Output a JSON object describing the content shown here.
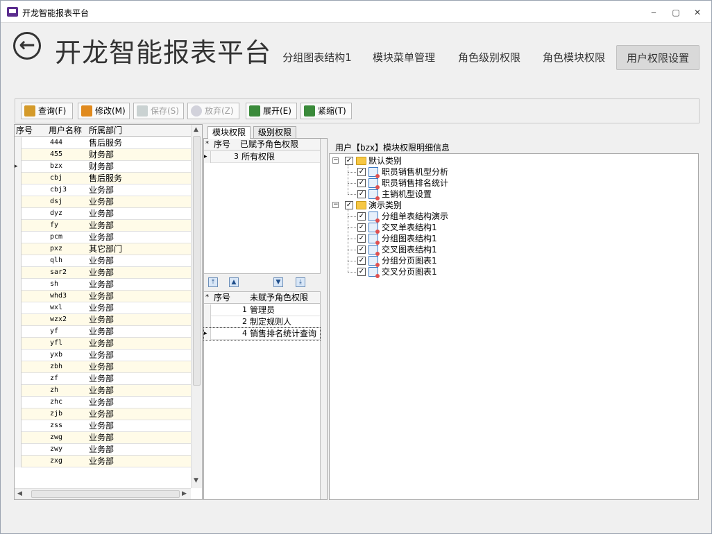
{
  "window": {
    "title": "开龙智能报表平台",
    "minimize": "‒",
    "maximize": "▢",
    "close": "✕"
  },
  "header": {
    "title": "开龙智能报表平台",
    "back_icon": "back-arrow-icon",
    "tabs": [
      {
        "label": "分组图表结构1"
      },
      {
        "label": "模块菜单管理"
      },
      {
        "label": "角色级别权限"
      },
      {
        "label": "角色模块权限"
      },
      {
        "label": "用户权限设置",
        "active": true
      }
    ]
  },
  "toolbar": {
    "buttons": [
      {
        "label": "查询(F)",
        "icon": "query-icon"
      },
      {
        "label": "修改(M)",
        "icon": "edit-icon"
      },
      {
        "label": "保存(S)",
        "icon": "save-icon",
        "disabled": true
      },
      {
        "label": "放弃(Z)",
        "icon": "discard-icon",
        "disabled": true
      },
      {
        "label": "展开(E)",
        "icon": "expand-icon"
      },
      {
        "label": "紧缩(T)",
        "icon": "collapse-icon"
      }
    ]
  },
  "user_grid": {
    "columns": [
      "序号",
      "用户名称",
      "所属部门"
    ],
    "rows": [
      [
        "444",
        "售后服务"
      ],
      [
        "455",
        "财务部"
      ],
      [
        "bzx",
        "财务部"
      ],
      [
        "cbj",
        "售后服务"
      ],
      [
        "cbj3",
        "业务部"
      ],
      [
        "dsj",
        "业务部"
      ],
      [
        "dyz",
        "业务部"
      ],
      [
        "fy",
        "业务部"
      ],
      [
        "pcm",
        "业务部"
      ],
      [
        "pxz",
        "其它部门"
      ],
      [
        "qlh",
        "业务部"
      ],
      [
        "sar2",
        "业务部"
      ],
      [
        "sh",
        "业务部"
      ],
      [
        "whd3",
        "业务部"
      ],
      [
        "wxl",
        "业务部"
      ],
      [
        "wzx2",
        "业务部"
      ],
      [
        "yf",
        "业务部"
      ],
      [
        "yfl",
        "业务部"
      ],
      [
        "yxb",
        "业务部"
      ],
      [
        "zbh",
        "业务部"
      ],
      [
        "zf",
        "业务部"
      ],
      [
        "zh",
        "业务部"
      ],
      [
        "zhc",
        "业务部"
      ],
      [
        "zjb",
        "业务部"
      ],
      [
        "zss",
        "业务部"
      ],
      [
        "zwg",
        "业务部"
      ],
      [
        "zwy",
        "业务部"
      ],
      [
        "zxg",
        "业务部"
      ]
    ],
    "current_row": 2
  },
  "role_tabs": [
    {
      "label": "模块权限",
      "selected": true
    },
    {
      "label": "级别权限"
    }
  ],
  "assigned_grid": {
    "columns": [
      "序号",
      "已赋予角色权限"
    ],
    "rows": [
      [
        "3",
        "所有权限"
      ]
    ]
  },
  "unassigned_grid": {
    "columns": [
      "序号",
      "未赋予角色权限"
    ],
    "rows": [
      [
        "1",
        "管理员"
      ],
      [
        "2",
        "制定规则人"
      ],
      [
        "4",
        "销售排名统计查询"
      ]
    ]
  },
  "detail": {
    "title": "用户【bzx】模块权限明细信息",
    "tree": [
      {
        "label": "默认类别",
        "children": [
          "职员销售机型分析",
          "职员销售排名统计",
          "主销机型设置"
        ]
      },
      {
        "label": "演示类别",
        "children": [
          "分组单表结构演示",
          "交叉单表结构1",
          "分组图表结构1",
          "交叉图表结构1",
          "分组分页图表1",
          "交叉分页图表1"
        ]
      }
    ]
  }
}
